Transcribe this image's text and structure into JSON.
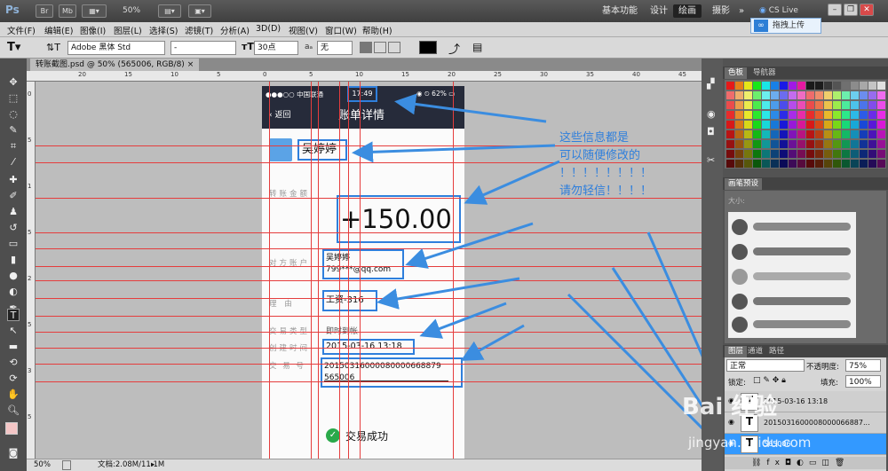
{
  "app": {
    "logo": "Ps",
    "mini_buttons": [
      "Br",
      "Mb"
    ],
    "zoom": "50%",
    "workspaces": [
      "基本功能",
      "设计",
      "绘画",
      "摄影"
    ],
    "active_workspace": "绘画",
    "overflow": "»",
    "cs_live": "CS Live"
  },
  "menu": [
    "文件(F)",
    "编辑(E)",
    "图像(I)",
    "图层(L)",
    "选择(S)",
    "滤镜(T)",
    "分析(A)",
    "3D(D)",
    "视图(V)",
    "窗口(W)",
    "帮助(H)"
  ],
  "options": {
    "font_family": "Adobe 黑体 Std",
    "font_style": "-",
    "font_size": "30点",
    "aa_label": "a",
    "antialias": "无",
    "tooltip": "拖拽上传"
  },
  "document": {
    "tab_title": "转账截图.psd @ 50% (565006, RGB/8)",
    "zoom": "50%",
    "doc_size": "文档:2.08M/11.1M"
  },
  "ruler_h": [
    "20",
    "15",
    "10",
    "5",
    "0",
    "5",
    "10",
    "15",
    "20",
    "25",
    "30",
    "35",
    "40",
    "45"
  ],
  "ruler_v": [
    "0",
    "5",
    "1",
    "5",
    "2",
    "5",
    "3",
    "5"
  ],
  "phone": {
    "carrier": "●●●○○ 中国联通",
    "time": "17:49",
    "battery": "62%",
    "back": "返回",
    "title": "账单详情",
    "name": "吴婷婷",
    "amount_label": "转账金额",
    "amount": "+150.00",
    "account_label": "对方账户",
    "account_name": "吴婷婷",
    "account_email": "799***@qq.com",
    "reason_label": "理    由",
    "reason": "工资-316",
    "type_label": "交易类型",
    "type": "即时到帐",
    "created_label": "创建时间",
    "created": "2015-03-16  13:18",
    "txn_label": "交  易  号",
    "txn_line1": "20150316000080000668879",
    "txn_line2": "565006",
    "success": "交易成功"
  },
  "annotation": {
    "line1": "这些信息都是",
    "line2": "可以随便修改的",
    "line3": "！！！！！！！！",
    "line4": "请勿轻信！！！！"
  },
  "panels": {
    "color_tabs": [
      "色板",
      "导航器"
    ],
    "brush_tabs": [
      "画笔预设"
    ],
    "brush_size_label": "大小:",
    "layer_tabs": [
      "图层",
      "通道",
      "路径"
    ],
    "blend_mode": "正常",
    "opacity_label": "不透明度:",
    "opacity": "75%",
    "lock_label": "锁定:",
    "fill_label": "填充:",
    "fill": "100%",
    "layers": [
      "2015-03-16  13:18",
      "2015031600008000066887...",
      "565006"
    ]
  },
  "watermark": {
    "brand": "Bai 经验",
    "url": "jingyan.baidu.com"
  },
  "colors": {
    "phone_header": "#262b3a",
    "highlight": "#2f7fdc",
    "guide": "#e53d3d",
    "success": "#2aa94a",
    "annotation": "#2f7fdc"
  }
}
